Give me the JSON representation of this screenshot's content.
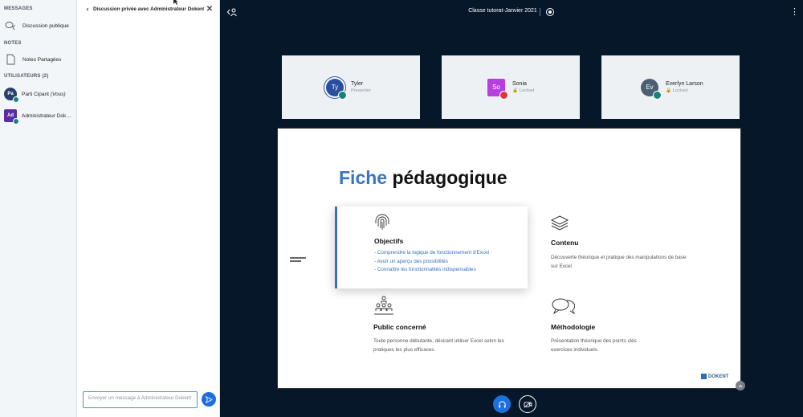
{
  "userlist": {
    "messages_title": "MESSAGES",
    "public_chat_label": "Discussion publique",
    "notes_title": "NOTES",
    "shared_notes_label": "Notes Partagées",
    "users_title": "UTILISATEURS (2)",
    "users": [
      {
        "initials": "Pa",
        "name": "Parti Cipant",
        "suffix": "(Vous)",
        "color": "#2a3f6a"
      },
      {
        "initials": "Ad",
        "name": "Administrateur Doke...",
        "suffix": "",
        "color": "#5a2ea0"
      }
    ]
  },
  "chat": {
    "back_icon": "chevron-left-icon",
    "title": "Discussion privée avec Administrateur Dokent",
    "close_icon": "close-icon",
    "input_placeholder": "Envoyer un message à Administrateur Dokent"
  },
  "topbar": {
    "meeting_title": "Classe tutorat-Janvier 2021",
    "options_icon": "more-vertical-icon",
    "record_icon": "record-icon"
  },
  "videos": [
    {
      "initials": "Ty",
      "name": "Tyler",
      "status": "Presenter",
      "avatar_color": "#2b4fa0",
      "mic": "unmuted"
    },
    {
      "initials": "So",
      "name": "Sonia",
      "status": "🔒 Locked",
      "avatar_color": "#b63fe0",
      "mic": "muted"
    },
    {
      "initials": "Ev",
      "name": "Everlyn Larson",
      "status": "🔒 Locked",
      "avatar_color": "#4a6072",
      "mic": "unmuted"
    }
  ],
  "slide": {
    "title_accent": "Fiche",
    "title_rest": "pédagogique",
    "objectifs": {
      "title": "Objectifs",
      "items": [
        "- Comprendre la logique de fonctionnement d'Excel",
        "- Avoir un aperçu des possibilités",
        "- Connaître les fonctionnalités indispensables"
      ]
    },
    "contenu": {
      "title": "Contenu",
      "text_line1": "Découverte théorique et pratique des manipulations de base",
      "text_line2": "sur Excel"
    },
    "public": {
      "title": "Public concerné",
      "text_line1": "Toute personne débutante, désirant utiliser Excel selon les",
      "text_line2": "pratiques les plus efficaces."
    },
    "methodologie": {
      "title": "Méthodologie",
      "text_line1": "Présentation théorique des points clés",
      "text_line2": "exercices individuels."
    },
    "brand": "DOKENT"
  },
  "controls": {
    "audio_icon": "headphones-icon",
    "video_icon": "video-off-icon"
  },
  "colors": {
    "background": "#06172a",
    "accent": "#1b6fde",
    "slide_accent": "#3a75c4"
  }
}
